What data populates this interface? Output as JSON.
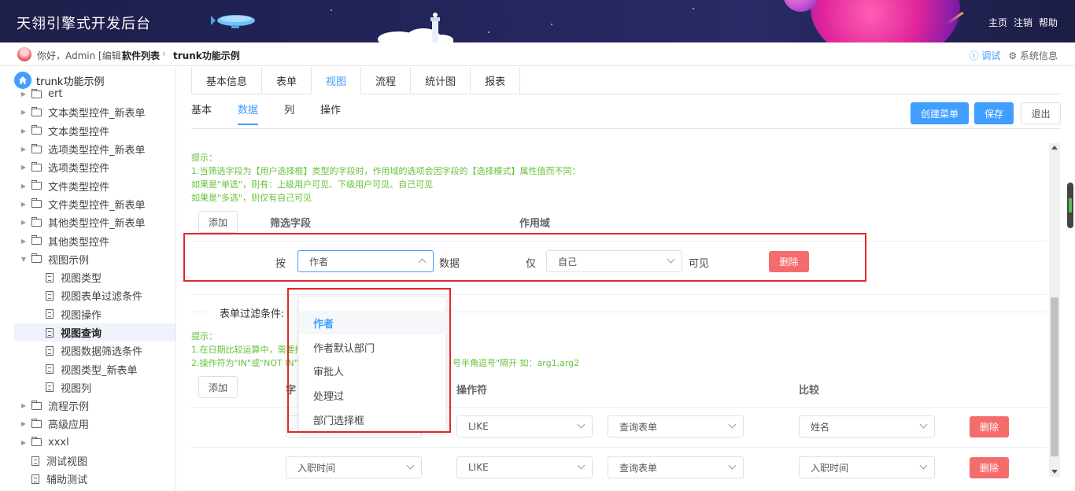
{
  "header": {
    "title": "天翎引擎式开发后台",
    "nav": [
      "主页",
      "注销",
      "帮助"
    ]
  },
  "crumbbar": {
    "greeting": "你好，Admin [编辑]",
    "crumbs": [
      "软件列表",
      "trunk功能示例"
    ],
    "debug": "ⓘ 调试",
    "sysinfo": "⚙ 系统信息"
  },
  "sidebar": {
    "root": "trunk功能示例",
    "items": [
      {
        "label": "ert",
        "type": "folder",
        "level": 1
      },
      {
        "label": "文本类型控件_新表单",
        "type": "folder",
        "level": 1
      },
      {
        "label": "文本类型控件",
        "type": "folder",
        "level": 1
      },
      {
        "label": "选项类型控件_新表单",
        "type": "folder",
        "level": 1
      },
      {
        "label": "选项类型控件",
        "type": "folder",
        "level": 1
      },
      {
        "label": "文件类型控件",
        "type": "folder",
        "level": 1
      },
      {
        "label": "文件类型控件_新表单",
        "type": "folder",
        "level": 1
      },
      {
        "label": "其他类型控件_新表单",
        "type": "folder",
        "level": 1
      },
      {
        "label": "其他类型控件",
        "type": "folder",
        "level": 1
      },
      {
        "label": "视图示例",
        "type": "folder-open",
        "level": 1
      },
      {
        "label": "视图类型",
        "type": "doc",
        "level": 2
      },
      {
        "label": "视图表单过滤条件",
        "type": "doc",
        "level": 2
      },
      {
        "label": "视图操作",
        "type": "doc",
        "level": 2
      },
      {
        "label": "视图查询",
        "type": "doc",
        "level": 2,
        "active": true
      },
      {
        "label": "视图数据筛选条件",
        "type": "doc",
        "level": 2
      },
      {
        "label": "视图类型_新表单",
        "type": "doc",
        "level": 2
      },
      {
        "label": "视图列",
        "type": "doc",
        "level": 2
      },
      {
        "label": "流程示例",
        "type": "folder",
        "level": 1
      },
      {
        "label": "高级应用",
        "type": "folder",
        "level": 1
      },
      {
        "label": "xxxl",
        "type": "folder",
        "level": 1
      },
      {
        "label": "测试视图",
        "type": "doc",
        "level": 1
      },
      {
        "label": "辅助测试",
        "type": "doc",
        "level": 1
      }
    ]
  },
  "tabs": [
    "基本信息",
    "表单",
    "视图",
    "流程",
    "统计图",
    "报表"
  ],
  "active_tab": "视图",
  "subtabs": [
    "基本",
    "数据",
    "列",
    "操作"
  ],
  "active_subtab": "数据",
  "toolbar": {
    "create_menu": "创建菜单",
    "save": "保存",
    "exit": "退出"
  },
  "filter_section": {
    "hint_lines": [
      "提示：",
      "1.当筛选字段为【用户选择框】类型的字段时，作用域的选项会因字段的【选择模式】属性值而不同：",
      "如果是\"单选\"，则有：上级用户可见、下级用户可见、自己可见",
      "如果是\"多选\"，则仅有自己可见"
    ],
    "add_label": "添加",
    "col_field": "筛选字段",
    "col_scope": "作用域",
    "row": {
      "prefix": "按",
      "field_value": "作者",
      "middle": "数据",
      "only": "仅",
      "scope_value": "自己",
      "suffix": "可见",
      "delete_label": "删除"
    }
  },
  "dropdown": {
    "options": [
      "作者",
      "作者默认部门",
      "审批人",
      "处理过",
      "部门选择框"
    ],
    "selected": "作者"
  },
  "form_filter": {
    "title": "表单过滤条件:",
    "hint_lines": [
      "提示：",
      "1.在日期比较运算中，需要把",
      "2.操作符为\"IN\"或\"NOT IN\"时",
      "号半角逗号\"隔开 如：arg1,arg2"
    ],
    "add_label": "添加",
    "col_field": "字",
    "col_operator": "操作符",
    "col_compare": "比较",
    "rows": [
      {
        "field": "",
        "operator": "LIKE",
        "source": "查询表单",
        "compare": "姓名",
        "delete_label": "删除"
      },
      {
        "field": "入职时间",
        "operator": "LIKE",
        "source": "查询表单",
        "compare": "入职时间",
        "delete_label": "删除"
      }
    ]
  }
}
